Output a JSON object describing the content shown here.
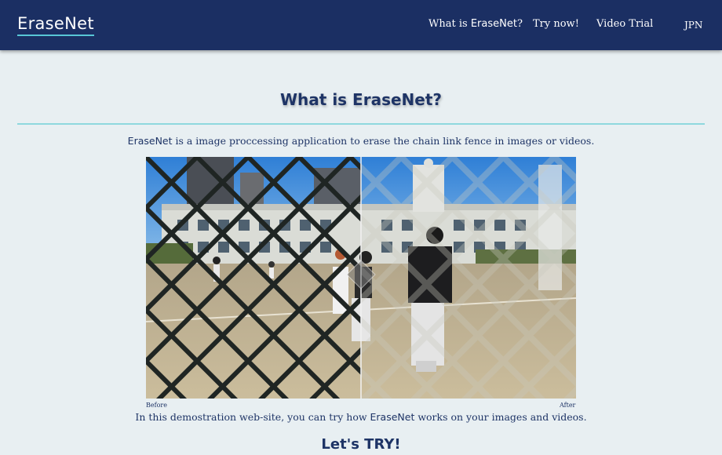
{
  "nav": {
    "logo": "EraseNet",
    "what_prefix": "What is ",
    "what_brand": "EraseNet",
    "what_suffix": "?",
    "try_now": "Try now!",
    "video_trial": "Video Trial",
    "language": "JPN"
  },
  "section": {
    "title": "What is EraseNet?",
    "intro_brand": "EraseNet",
    "intro_rest": " is a image proccessing application to erase the chain link fence in images or videos."
  },
  "comparison": {
    "before_label": "Before",
    "after_label": "After",
    "divider_position": 0.5
  },
  "demo": {
    "prefix": "In this demostration web-site, you can try how ",
    "brand": "EraseNet",
    "suffix": " works on your images and videos."
  },
  "cta": {
    "title": "Let's TRY!"
  },
  "colors": {
    "navbar": "#1b2f63",
    "accent": "#58c6d6",
    "background": "#e8eff2",
    "text": "#1e3466"
  }
}
